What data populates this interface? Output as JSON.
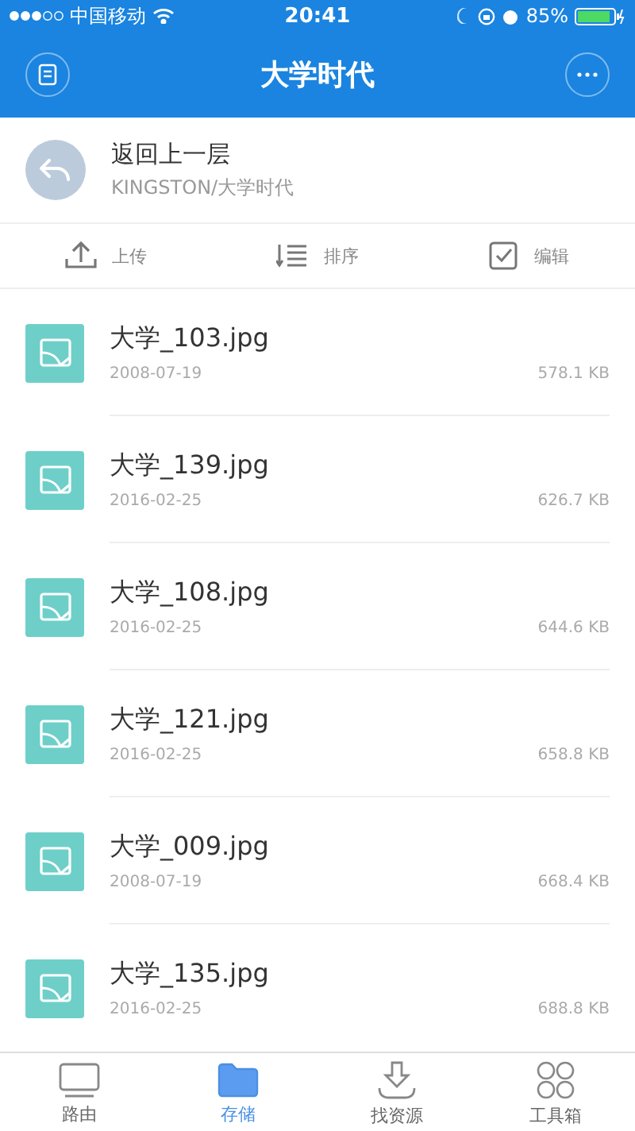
{
  "status_bar": {
    "carrier": "中国移动",
    "time": "20:41",
    "battery": "85%"
  },
  "nav_bar": {
    "title": "大学时代"
  },
  "parent_folder": {
    "label": "返回上一层",
    "path": "KINGSTON/大学时代"
  },
  "toolbar": [
    {
      "kind": "upload",
      "label": "上传"
    },
    {
      "kind": "sort",
      "label": "排序"
    },
    {
      "kind": "edit",
      "label": "编辑"
    }
  ],
  "files": [
    {
      "name": "大学_103.jpg",
      "date": "2008-07-19",
      "size": "578.1 KB"
    },
    {
      "name": "大学_139.jpg",
      "date": "2016-02-25",
      "size": "626.7 KB"
    },
    {
      "name": "大学_108.jpg",
      "date": "2016-02-25",
      "size": "644.6 KB"
    },
    {
      "name": "大学_121.jpg",
      "date": "2016-02-25",
      "size": "658.8 KB"
    },
    {
      "name": "大学_009.jpg",
      "date": "2008-07-19",
      "size": "668.4 KB"
    },
    {
      "name": "大学_135.jpg",
      "date": "2016-02-25",
      "size": "688.8 KB"
    }
  ],
  "tab_bar": [
    {
      "kind": "router",
      "label": "路由",
      "selected": false
    },
    {
      "kind": "storage",
      "label": "存储",
      "selected": true
    },
    {
      "kind": "resources",
      "label": "找资源",
      "selected": false
    },
    {
      "kind": "tools",
      "label": "工具箱",
      "selected": false
    }
  ]
}
